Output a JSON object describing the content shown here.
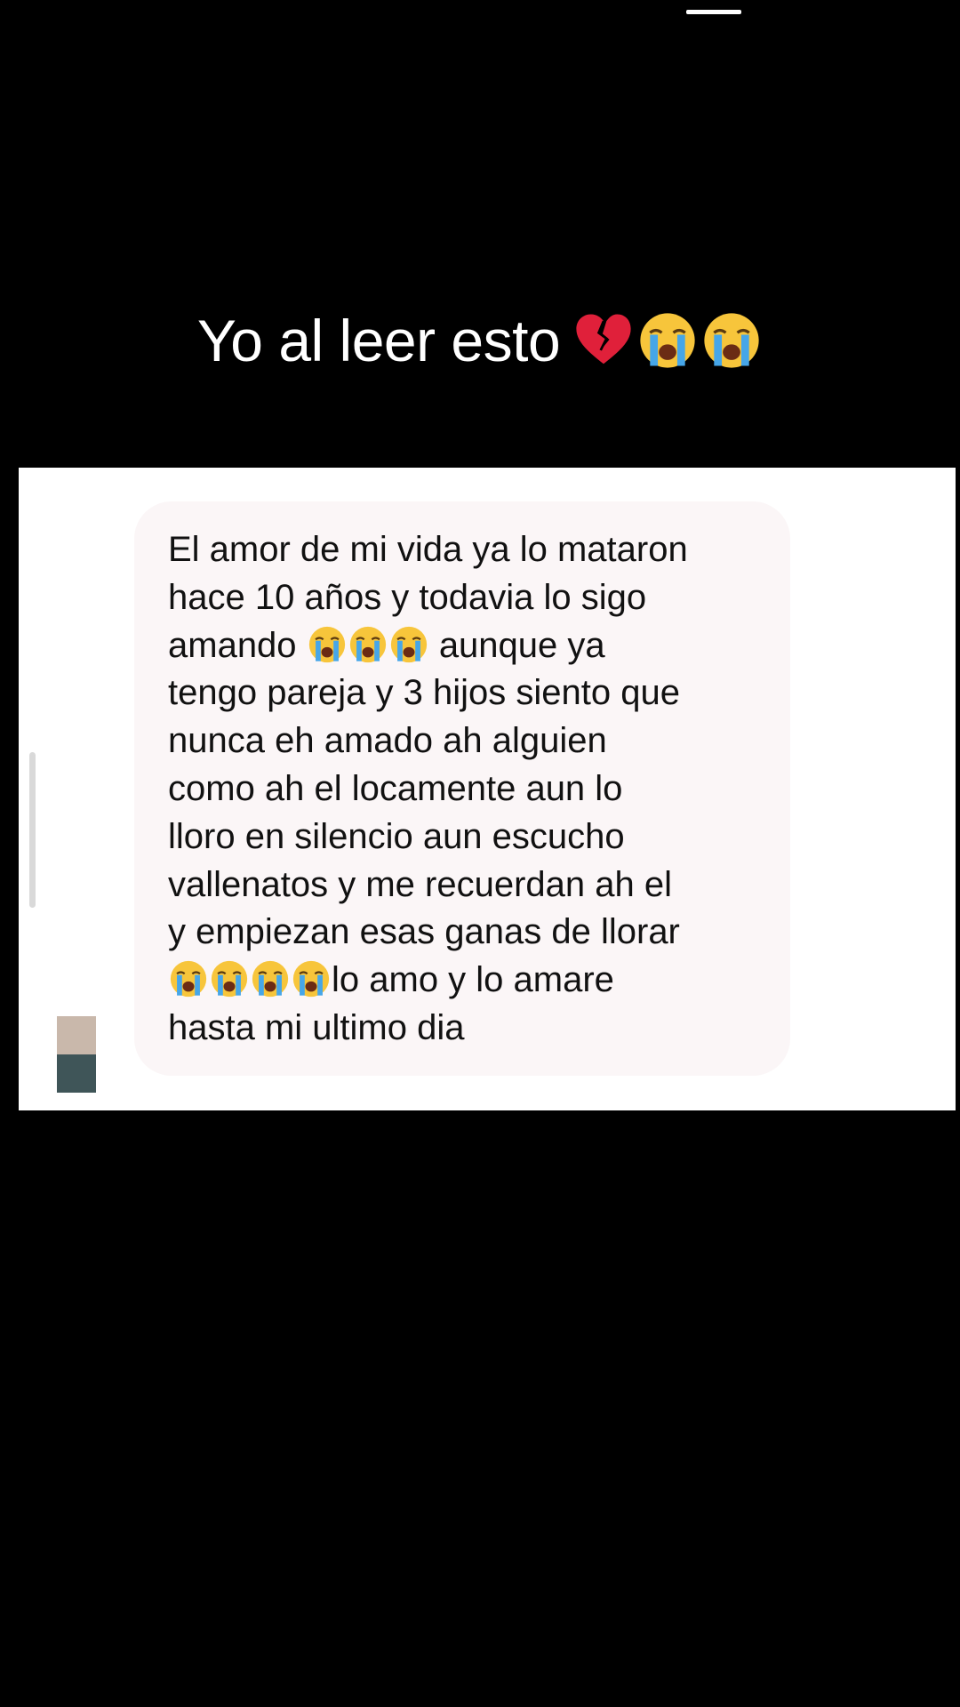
{
  "caption": {
    "text": "Yo al leer esto",
    "emojis": [
      "broken-heart",
      "loudly-crying-face",
      "loudly-crying-face"
    ]
  },
  "message": {
    "lines": [
      "El amor de mi vida ya lo mataron",
      "hace 10 años y todavia lo sigo",
      "amando",
      "aunque ya",
      "tengo pareja y 3 hijos siento que",
      "nunca eh amado ah alguien",
      "como ah el locamente aun lo",
      "lloro en silencio aun escucho",
      "vallenatos y me recuerdan ah el",
      "y empiezan esas ganas de llorar",
      "lo amo y lo amare",
      "hasta mi ultimo dia"
    ]
  },
  "colors": {
    "background": "#000000",
    "panel": "#ffffff",
    "bubble": "#fbf6f7",
    "avatar_top": "#c9b8ab",
    "avatar_bottom": "#3f5558"
  }
}
